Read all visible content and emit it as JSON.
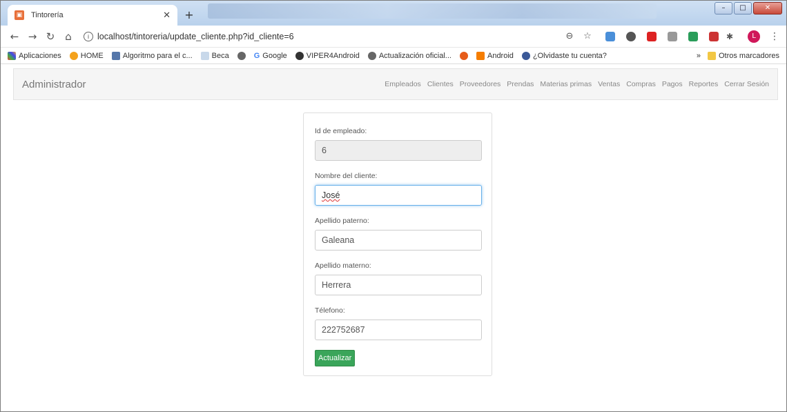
{
  "browser": {
    "tab_title": "Tintorería",
    "url": "localhost/tintoreria/update_cliente.php?id_cliente=6",
    "profile_initial": "L",
    "bookmarks": [
      "Aplicaciones",
      "HOME",
      "Algoritmo para el c...",
      "Beca",
      "Google",
      "VIPER4Android",
      "Actualización oficial...",
      "Android",
      "¿Olvidaste tu cuenta?"
    ],
    "bookmarks_overflow": "»",
    "other_bookmarks": "Otros marcadores"
  },
  "navbar": {
    "brand": "Administrador",
    "links": [
      "Empleados",
      "Clientes",
      "Proveedores",
      "Prendas",
      "Materias primas",
      "Ventas",
      "Compras",
      "Pagos",
      "Reportes",
      "Cerrar Sesión"
    ]
  },
  "form": {
    "fields": [
      {
        "label": "Id de empleado:",
        "value": "6"
      },
      {
        "label": "Nombre del cliente:",
        "value": "José"
      },
      {
        "label": "Apellido paterno:",
        "value": "Galeana"
      },
      {
        "label": "Apellido materno:",
        "value": "Herrera"
      },
      {
        "label": "Télefono:",
        "value": "222752687"
      }
    ],
    "submit_label": "Actualizar"
  },
  "colors": {
    "submit_button": "#3aa55a",
    "focus_ring": "#66afe9"
  }
}
